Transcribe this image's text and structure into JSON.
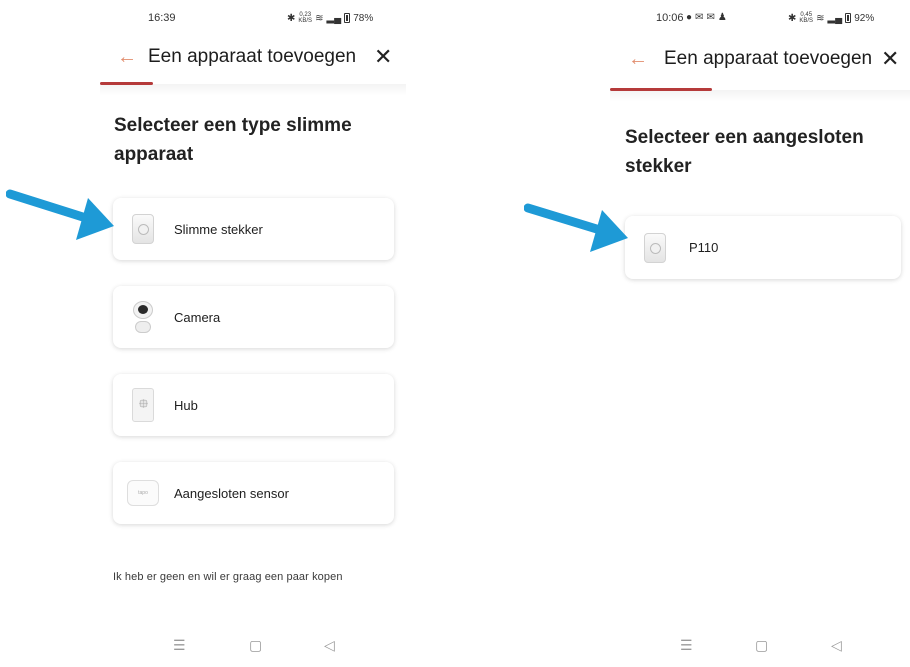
{
  "left_screen": {
    "status_bar": {
      "time": "16:39",
      "network_speed": "0,23",
      "network_unit": "KB/S",
      "battery": "78%"
    },
    "header": {
      "title": "Een apparaat toevoegen",
      "back_icon": "arrow-left-icon",
      "close_icon": "close-icon"
    },
    "heading_line1": "Selecteer een type slimme",
    "heading_line2": "apparaat",
    "device_types": [
      {
        "label": "Slimme stekker",
        "icon": "smart-plug-icon"
      },
      {
        "label": "Camera",
        "icon": "camera-icon"
      },
      {
        "label": "Hub",
        "icon": "hub-icon"
      },
      {
        "label": "Aangesloten sensor",
        "icon": "sensor-icon"
      }
    ],
    "sensor_brand": "tapo",
    "bottom_link": "Ik heb er geen en wil er graag een paar kopen"
  },
  "right_screen": {
    "status_bar": {
      "time": "10:06",
      "network_speed": "0,45",
      "network_unit": "KB/S",
      "battery": "92%"
    },
    "header": {
      "title": "Een apparaat toevoegen",
      "back_icon": "arrow-left-icon",
      "close_icon": "close-icon"
    },
    "heading_line1": "Selecteer een aangesloten",
    "heading_line2": "stekker",
    "devices": [
      {
        "label": "P110",
        "icon": "smart-plug-icon"
      }
    ]
  },
  "colors": {
    "accent_back": "#e28d6e",
    "progress": "#b53a3a",
    "annotation_arrow": "#1e9ad6"
  },
  "nav_icons": [
    "menu-icon",
    "home-icon",
    "back-triangle-icon"
  ],
  "nav_glyphs": {
    "menu": "☰",
    "home": "▢",
    "back": "◁"
  },
  "glyphs": {
    "back": "←",
    "close": "✕"
  }
}
